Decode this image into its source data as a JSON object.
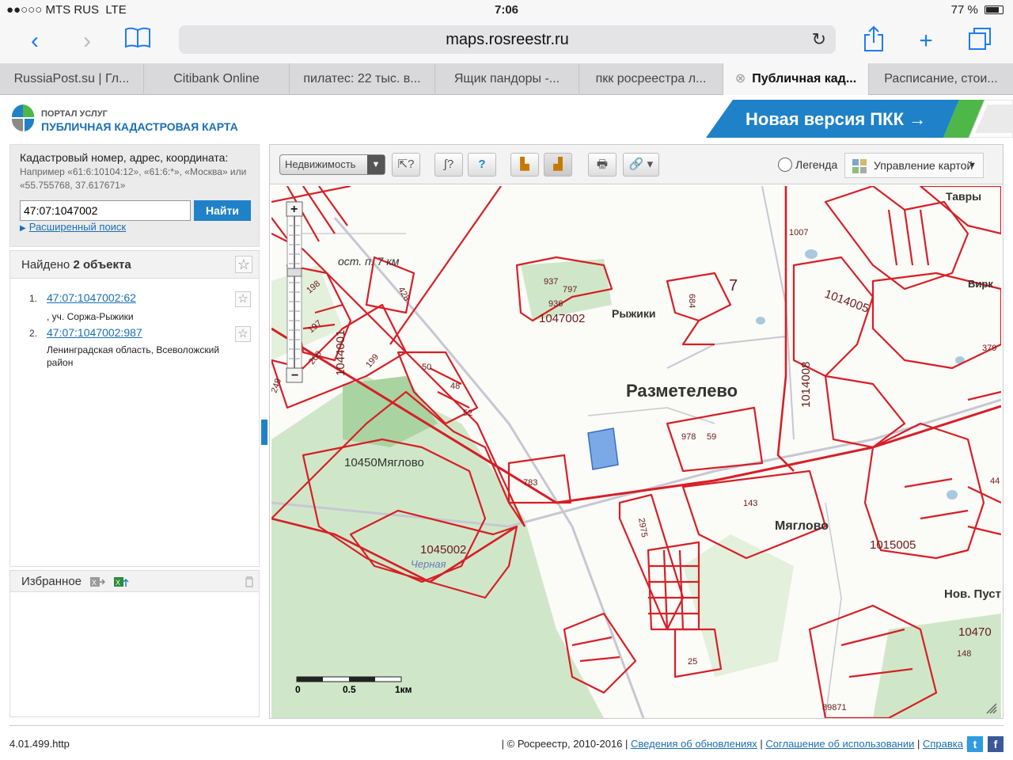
{
  "status": {
    "carrier": "MTS RUS",
    "network": "LTE",
    "time": "7:06",
    "battery": "77 %"
  },
  "browser": {
    "url": "maps.rosreestr.ru"
  },
  "tabs": [
    {
      "label": "RussiaPost.su | Гл..."
    },
    {
      "label": "Citibank Online"
    },
    {
      "label": "пилатес: 22 тыс. в..."
    },
    {
      "label": "Ящик пандоры -..."
    },
    {
      "label": "пкк росреестра л..."
    },
    {
      "label": "Публичная кад..."
    },
    {
      "label": "Расписание, стои..."
    }
  ],
  "header": {
    "portal": "ПОРТАЛ УСЛУГ",
    "title": "ПУБЛИЧНАЯ КАДАСТРОВАЯ КАРТА",
    "new_version": "Новая версия ПКК →"
  },
  "search": {
    "label": "Кадастровый номер, адрес, координата:",
    "hint": "Например «61:6:10104:12», «61:6:*», «Москва» или «55.755768, 37.617671»",
    "value": "47:07:1047002",
    "button": "Найти",
    "advanced": "Расширенный поиск"
  },
  "results": {
    "found_prefix": "Найдено",
    "found_count": "2 объекта",
    "items": [
      {
        "num": "1.",
        "link": "47:07:1047002:62",
        "addr": ", уч. Соржа-Рыжики"
      },
      {
        "num": "2.",
        "link": "47:07:1047002:987",
        "addr": "Ленинградская область, Всеволожский район"
      }
    ]
  },
  "favorites": {
    "label": "Избранное"
  },
  "toolbar": {
    "layer": "Недвижимость",
    "legend": "Легенда",
    "map_control": "Управление картой"
  },
  "map": {
    "labels": {
      "stop": "ост. п. 7 км",
      "ryzhiki": "Рыжики",
      "razmetelevo": "Разметелево",
      "myaglovo1": "10450Мяглово",
      "myaglovo2": "Мяглово",
      "chernaya": "Черная",
      "tavry": "Тавры",
      "nov_pust": "Нов. Пуст",
      "virk": "Вирк"
    },
    "numbers": [
      "1047002",
      "1045002",
      "1014008",
      "1014005",
      "1015005",
      "1044001",
      "937",
      "797",
      "936",
      "7",
      "1007",
      "379",
      "978",
      "59",
      "783",
      "143",
      "2975",
      "25",
      "89871",
      "10470",
      "148",
      "198",
      "197",
      "200",
      "199",
      "428",
      "50",
      "48",
      "52",
      "248",
      "684",
      "44"
    ],
    "scale": {
      "s0": "0",
      "s1": "0.5",
      "s2": "1км"
    }
  },
  "footer": {
    "version": "4.01.499.http",
    "copyright": "| © Росреестр, 2010-2016 |",
    "link1": "Сведения об обновлениях",
    "link2": "Соглашение об использовании",
    "link3": "Справка"
  },
  "colors": {
    "accent": "#1f82c8",
    "parcel": "#d61f26",
    "link": "#1a6fb3"
  }
}
